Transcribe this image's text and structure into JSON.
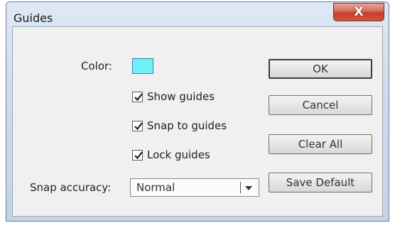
{
  "window": {
    "title": "Guides",
    "close_glyph": "X"
  },
  "form": {
    "color_label": "Color:",
    "color_value": "#6ff0f7",
    "show_guides_label": "Show guides",
    "show_guides_checked": true,
    "snap_to_guides_label": "Snap to guides",
    "snap_to_guides_checked": true,
    "lock_guides_label": "Lock guides",
    "lock_guides_checked": true,
    "snap_accuracy_label": "Snap accuracy:",
    "snap_accuracy_value": "Normal"
  },
  "buttons": {
    "ok": "OK",
    "cancel": "Cancel",
    "clear_all": "Clear All",
    "save_default": "Save Default"
  },
  "icons": {
    "close": "close-icon",
    "check": "checkmark-icon",
    "dropdown": "chevron-down-icon"
  }
}
